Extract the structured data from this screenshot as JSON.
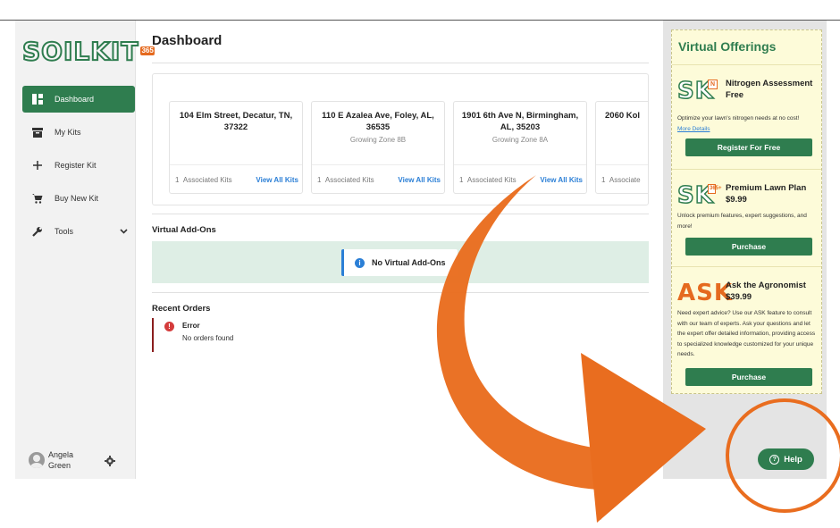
{
  "app": {
    "logo_text": "SOILKIT",
    "logo_suffix": "365"
  },
  "sidebar": {
    "items": [
      {
        "label": "Dashboard",
        "icon": "dashboard-icon"
      },
      {
        "label": "My Kits",
        "icon": "kit-box-icon"
      },
      {
        "label": "Register Kit",
        "icon": "plus-icon"
      },
      {
        "label": "Buy New Kit",
        "icon": "cart-icon"
      },
      {
        "label": "Tools",
        "icon": "wrench-icon"
      }
    ],
    "user": {
      "name": "Angela Green"
    }
  },
  "main": {
    "title": "Dashboard",
    "cards": [
      {
        "address": "104 Elm Street, Decatur, TN, 37322",
        "zone": "",
        "count": "1",
        "count_label": "Associated Kits",
        "link": "View All Kits"
      },
      {
        "address": "110 E Azalea Ave, Foley, AL, 36535",
        "zone": "Growing Zone 8B",
        "count": "1",
        "count_label": "Associated Kits",
        "link": "View All Kits"
      },
      {
        "address": "1901 6th Ave N, Birmingham, AL, 35203",
        "zone": "Growing Zone 8A",
        "count": "1",
        "count_label": "Associated Kits",
        "link": "View All Kits"
      },
      {
        "address": "2060 Kol",
        "zone": "",
        "count": "1",
        "count_label": "Associate",
        "link": ""
      }
    ],
    "addons": {
      "title": "Virtual Add-Ons",
      "empty": "No Virtual Add-Ons"
    },
    "orders": {
      "title": "Recent Orders",
      "error_title": "Error",
      "error_msg": "No orders found"
    }
  },
  "offerings": {
    "title": "Virtual Offerings",
    "items": [
      {
        "logo": "SK",
        "badge": "N",
        "name": "Nitrogen Assessment Free",
        "desc": "Optimize your lawn's nitrogen needs at no cost!",
        "link": "More Details",
        "button": "Register For Free"
      },
      {
        "logo": "SK",
        "badge": "365+",
        "name": "Premium Lawn Plan",
        "price": "$9.99",
        "desc": "Unlock premium features, expert suggestions, and more!",
        "button": "Purchase"
      },
      {
        "logo": "ASK",
        "name": "Ask the Agronomist",
        "price": "$39.99",
        "desc": "Need expert advice? Use our ASK feature to consult with our team of experts. Ask your questions and let the expert offer detailed information, providing access to specialized knowledge customized for your unique needs.",
        "button": "Purchase"
      }
    ]
  },
  "help": {
    "label": "Help"
  },
  "colors": {
    "brand_green": "#2f7d4f",
    "accent_orange": "#e56a1f",
    "link_blue": "#2b7fd6",
    "offer_bg": "#fdfbd9"
  }
}
